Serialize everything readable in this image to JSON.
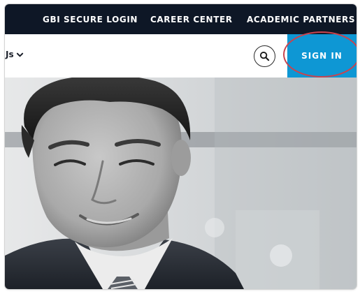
{
  "topbar": {
    "links": [
      {
        "label": "GBI SECURE LOGIN"
      },
      {
        "label": "CAREER CENTER"
      },
      {
        "label": "ACADEMIC PARTNERS"
      }
    ]
  },
  "nav": {
    "partial_item": "Js",
    "chevron_icon": "chevron-down-icon",
    "search_icon": "search-icon",
    "signin_label": "SIGN IN"
  },
  "colors": {
    "topbar_bg": "#0e1726",
    "signin_bg": "#0e97d4",
    "annotation": "#c8444f"
  },
  "hero": {
    "image": "black-and-white photo of smiling man in suit"
  }
}
